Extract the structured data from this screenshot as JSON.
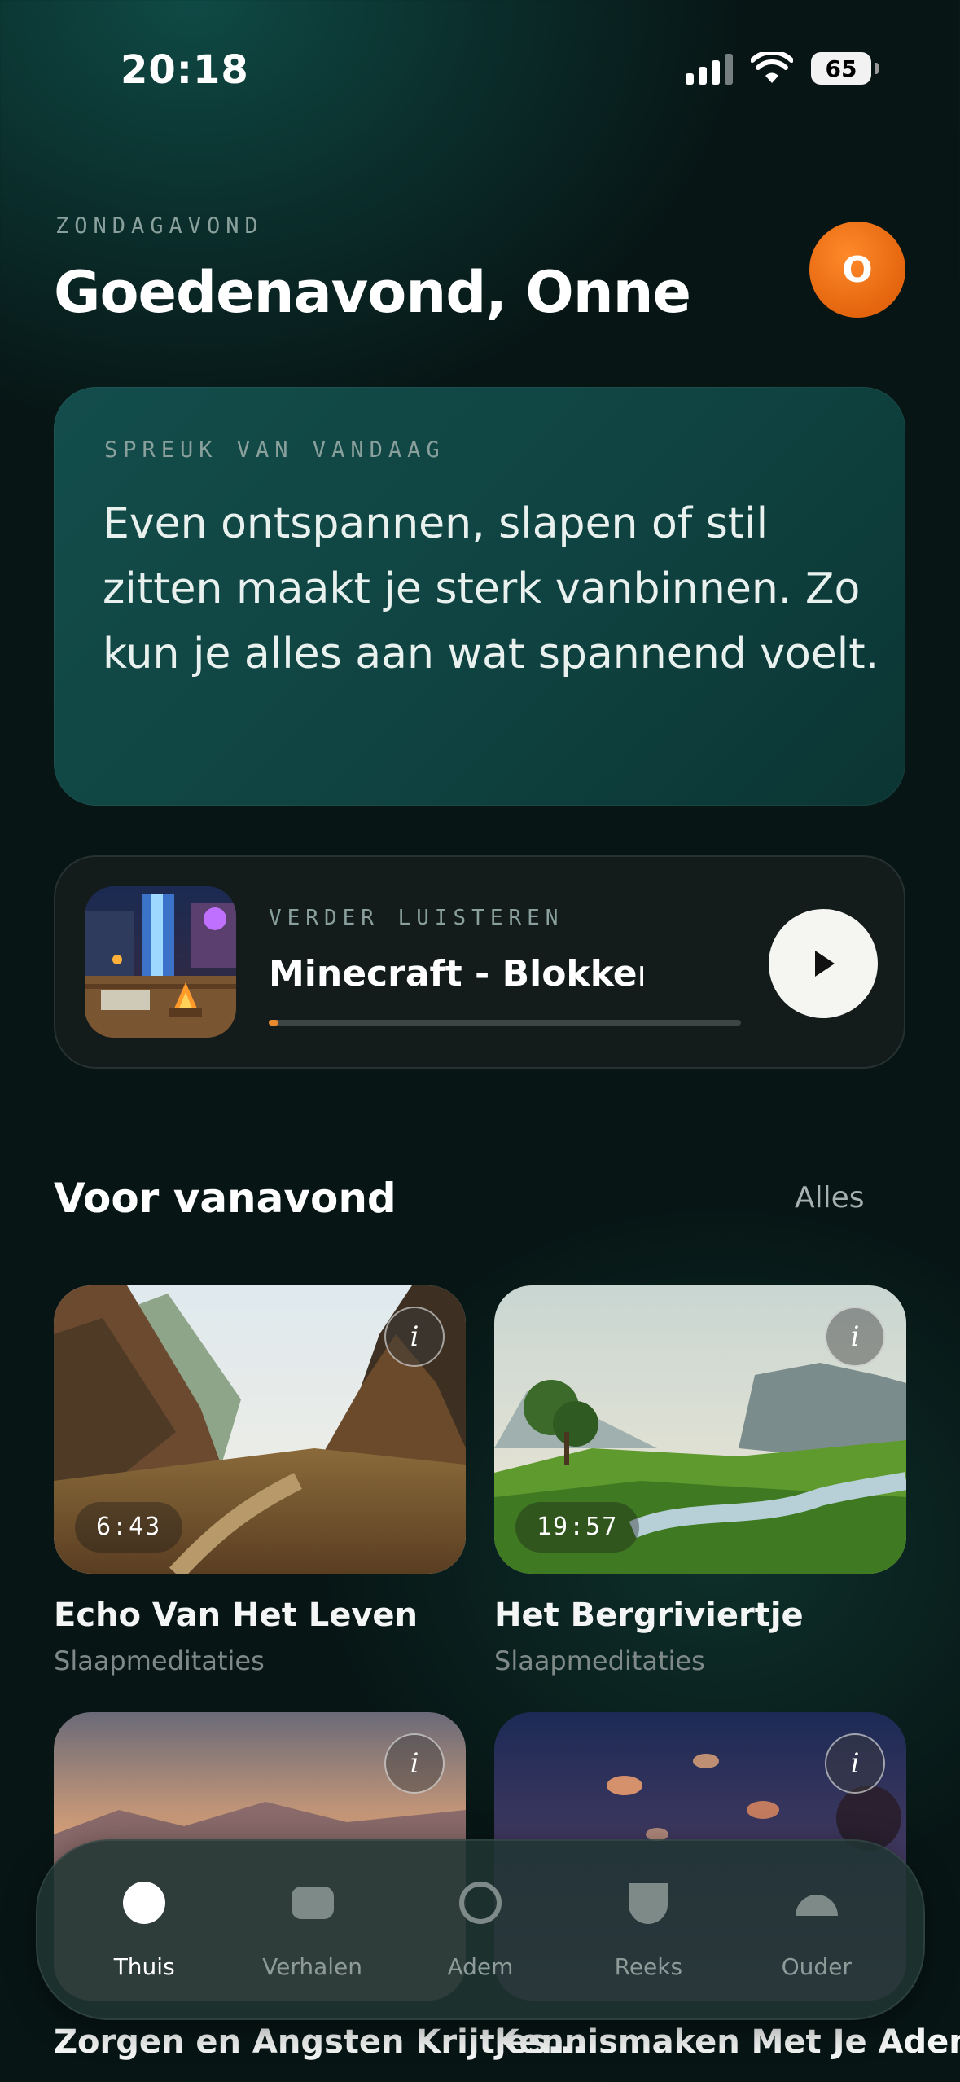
{
  "status_bar": {
    "time": "20:18",
    "battery": "65"
  },
  "header": {
    "day_label": "ZONDAGAVOND",
    "greeting": "Goedenavond, Onne",
    "avatar_initial": "O"
  },
  "quote": {
    "label": "SPREUK VAN VANDAAG",
    "text": "Even ontspannen, slapen of stil zitten maakt je sterk vanbinnen. Zo kun je alles aan wat spannend voelt."
  },
  "continue_listening": {
    "label": "VERDER LUISTEREN",
    "title": "Minecraft - Blokken Van ...",
    "progress": 0.02
  },
  "section": {
    "title": "Voor vanavond",
    "link": "Alles"
  },
  "cards": [
    {
      "title": "Echo Van Het Leven",
      "subtitle": "Slaapmeditaties",
      "duration": "6:43",
      "info": "i"
    },
    {
      "title": "Het Bergriviertje",
      "subtitle": "Slaapmeditaties",
      "duration": "19:57",
      "info": "i"
    },
    {
      "title": "Zorgen en Angsten Krijtjes...",
      "subtitle": "",
      "duration": "",
      "info": "i"
    },
    {
      "title": "Kennismaken Met Je Adem",
      "subtitle": "",
      "duration": "",
      "info": "i"
    }
  ],
  "tabs": [
    {
      "label": "Thuis",
      "icon": "home-circle-icon",
      "active": true
    },
    {
      "label": "Verhalen",
      "icon": "stories-rect-icon",
      "active": false
    },
    {
      "label": "Adem",
      "icon": "breath-ring-icon",
      "active": false
    },
    {
      "label": "Reeks",
      "icon": "series-shield-icon",
      "active": false
    },
    {
      "label": "Ouder",
      "icon": "parent-dome-icon",
      "active": false
    }
  ],
  "colors": {
    "accent": "#e8892f",
    "avatar": "#e4650e",
    "quote_card": "#134d4b"
  }
}
